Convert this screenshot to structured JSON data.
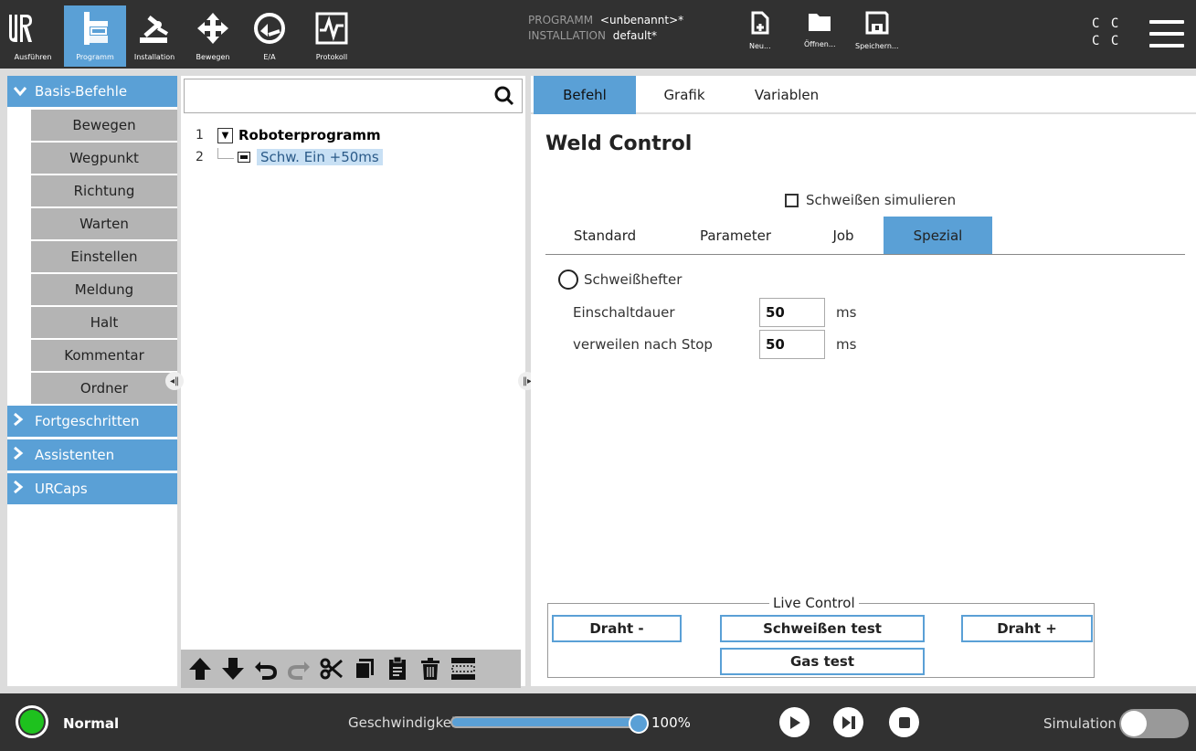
{
  "header": {
    "nav": [
      {
        "id": "run",
        "label": "Ausführen"
      },
      {
        "id": "program",
        "label": "Programm"
      },
      {
        "id": "installation",
        "label": "Installation"
      },
      {
        "id": "move",
        "label": "Bewegen"
      },
      {
        "id": "io",
        "label": "E/A"
      },
      {
        "id": "log",
        "label": "Protokoll"
      }
    ],
    "program_key": "PROGRAMM",
    "program_value": "<unbenannt>*",
    "installation_key": "INSTALLATION",
    "installation_value": "default*",
    "file_buttons": {
      "new": "Neu...",
      "open": "Öffnen...",
      "save": "Speichern..."
    },
    "cc_top": "C C",
    "cc_bottom": "C C"
  },
  "left": {
    "basic_category": "Basis-Befehle",
    "commands": [
      "Bewegen",
      "Wegpunkt",
      "Richtung",
      "Warten",
      "Einstellen",
      "Meldung",
      "Halt",
      "Kommentar",
      "Ordner"
    ],
    "advanced": "Fortgeschritten",
    "wizards": "Assistenten",
    "urcaps": "URCaps"
  },
  "tree": {
    "search_value": "",
    "rows": [
      {
        "num": "1",
        "label": "Roboterprogramm"
      },
      {
        "num": "2",
        "label": "Schw. Ein +50ms"
      }
    ]
  },
  "right": {
    "tabs": [
      "Befehl",
      "Grafik",
      "Variablen"
    ],
    "title": "Weld Control",
    "simulate_label": "Schweißen simulieren",
    "subtabs": [
      "Standard",
      "Parameter",
      "Job",
      "Spezial"
    ],
    "tack_weld_label": "Schweißhefter",
    "fields": [
      {
        "label": "Einschaltdauer",
        "value": "50",
        "unit": "ms"
      },
      {
        "label": "verweilen nach Stop",
        "value": "50",
        "unit": "ms"
      }
    ],
    "live_control": {
      "title": "Live Control",
      "wire_minus": "Draht -",
      "weld_test": "Schweißen test",
      "wire_plus": "Draht +",
      "gas_test": "Gas test"
    }
  },
  "footer": {
    "status": "Normal",
    "speed_label": "Geschwindigkeit",
    "speed_value": "100%",
    "speed_fraction": 1.0,
    "simulation_label": "Simulation",
    "simulation_on": false
  },
  "colors": {
    "accent": "#5aa0d6",
    "bar": "#313131",
    "status_ok": "#1ec11e"
  }
}
